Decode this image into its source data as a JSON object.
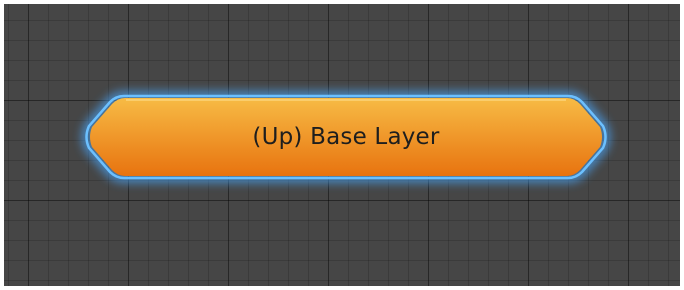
{
  "graph": {
    "background_color": "#464646",
    "state_node": {
      "label": "(Up) Base Layer",
      "fill_top_color": "#f7bb45",
      "fill_bottom_color": "#e8730f",
      "highlight_color": "#4aa8ff",
      "selected": true
    }
  }
}
